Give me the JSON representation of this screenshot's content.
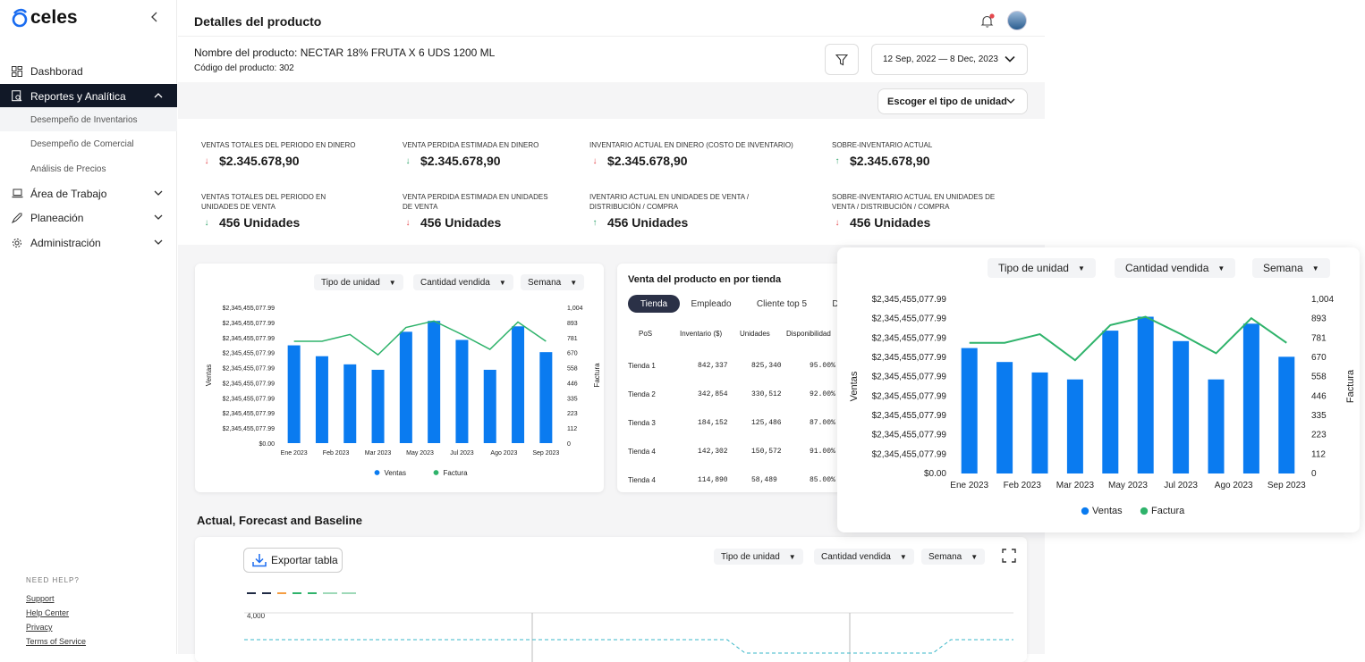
{
  "sidebar": {
    "logo": "celes",
    "nav": [
      {
        "label": "Dashborad"
      },
      {
        "label": "Reportes y Analítica"
      },
      {
        "label": "Área de Trabajo"
      },
      {
        "label": "Planeación"
      },
      {
        "label": "Administración"
      }
    ],
    "subnav": [
      "Desempeño de Inventarios",
      "Desempeño de Comercial",
      "Análisis de Precios"
    ],
    "help_title": "NEED HELP?",
    "help_links": [
      "Support",
      "Help Center",
      "Privacy",
      "Terms of Service"
    ]
  },
  "header": {
    "title": "Detalles del producto"
  },
  "product": {
    "name": "Nombre del producto: NECTAR 18% FRUTA X 6 UDS 1200 ML",
    "code": "Código del producto: 302",
    "date_range": "12 Sep, 2022 — 8 Dec, 2023",
    "unit_type_btn": "Escoger el tipo de unidad"
  },
  "kpis": [
    {
      "label": "VENTAS TOTALES DEL PERIODO EN DINERO",
      "value": "$2.345.678,90",
      "trend": "down"
    },
    {
      "label": "VENTA PERDIDA ESTIMADA EN DINERO",
      "value": "$2.345.678,90",
      "trend": "down"
    },
    {
      "label": "INVENTARIO ACTUAL EN DINERO (COSTO DE INVENTARIO)",
      "value": "$2.345.678,90",
      "trend": "down"
    },
    {
      "label": "SOBRE-INVENTARIO ACTUAL",
      "value": "$2.345.678,90",
      "trend": "up"
    },
    {
      "label": "VENTAS TOTALES DEL PERIODO EN UNIDADES DE VENTA",
      "value": "456 Unidades",
      "trend": "down"
    },
    {
      "label": "VENTA PERDIDA ESTIMADA EN UNIDADES DE VENTA",
      "value": "456 Unidades",
      "trend": "down"
    },
    {
      "label": "IVENTARIO ACTUAL EN UNIDADES DE VENTA / DISTRIBUCIÓN / COMPRA",
      "value": "456 Unidades",
      "trend": "up"
    },
    {
      "label": "SOBRE-INVENTARIO ACTUAL EN UNIDADES DE VENTA / DISTRIBUCIÓN / COMPRA",
      "value": "456 Unidades",
      "trend": "down"
    }
  ],
  "filters": {
    "unit": "Tipo de unidad",
    "qty": "Cantidad vendida",
    "period": "Semana"
  },
  "store_table": {
    "title": "Venta del producto en por tienda",
    "tabs": [
      "Tienda",
      "Empleado",
      "Cliente top 5",
      "D"
    ],
    "headers": [
      "PoS",
      "Inventario ($)",
      "Unidades",
      "Disponibilidad"
    ],
    "rows": [
      [
        "Tienda 1",
        "842,337",
        "825,340",
        "95.00%"
      ],
      [
        "Tienda 2",
        "342,854",
        "330,512",
        "92.00%"
      ],
      [
        "Tienda 3",
        "184,152",
        "125,486",
        "87.00%"
      ],
      [
        "Tienda 4",
        "142,302",
        "150,572",
        "91.00%"
      ],
      [
        "Tienda 4",
        "114,890",
        "58,489",
        "85.00%"
      ]
    ]
  },
  "forecast": {
    "title": "Actual, Forecast and Baseline",
    "export_label": "Exportar tabla",
    "ytick": "4,000"
  },
  "chart_data": {
    "type": "bar",
    "categories": [
      "Ene 2023",
      "Feb 2023",
      "Mar 2023",
      "May 2023",
      "Jul 2023",
      "Ago 2023",
      "Sep 2023"
    ],
    "x_ticks": [
      "Ene 2023",
      "Feb 2023",
      "Mar 2023",
      "May 2023",
      "Jul 2023",
      "Ago 2023",
      "Sep 2023"
    ],
    "ylabel": "Ventas",
    "y2label": "Factura",
    "y_ticks": [
      "$2,345,455,077.99",
      "$2,345,455,077.99",
      "$2,345,455,077.99",
      "$2,345,455,077.99",
      "$2,345,455,077.99",
      "$2,345,455,077.99",
      "$2,345,455,077.99",
      "$2,345,455,077.99",
      "$2,345,455,077.99",
      "$0.00"
    ],
    "y2_ticks": [
      "1,004",
      "893",
      "781",
      "670",
      "558",
      "446",
      "335",
      "223",
      "112",
      "0"
    ],
    "y2lim": [
      0,
      1004
    ],
    "bar_fraction": [
      0.72,
      0.64,
      0.58,
      0.54,
      0.82,
      0.9,
      0.76,
      0.54,
      0.86,
      0.67
    ],
    "line_values": [
      753,
      753,
      803,
      653,
      855,
      903,
      803,
      693,
      895,
      753
    ],
    "series": [
      {
        "name": "Ventas",
        "color": "#0a7bf0"
      },
      {
        "name": "Factura",
        "color": "#2fb36b"
      }
    ]
  }
}
